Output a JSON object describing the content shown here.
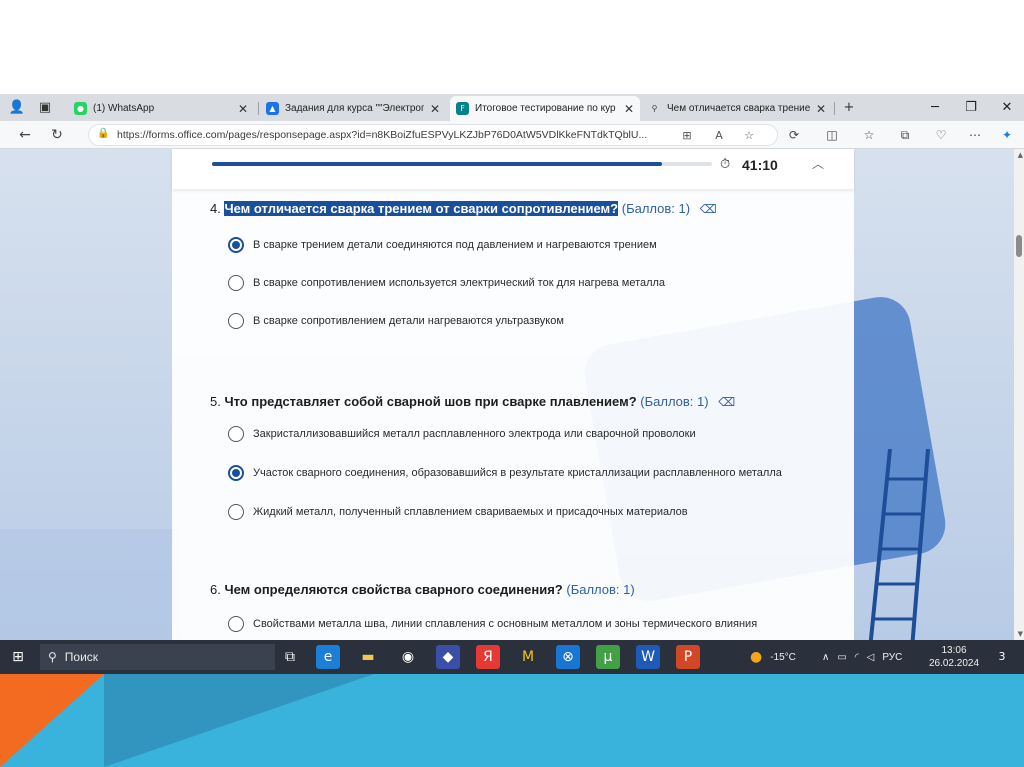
{
  "browser": {
    "tabs": [
      {
        "label": "(1) WhatsApp",
        "favicon": "whatsapp-icon",
        "color": "#25d366",
        "active": false
      },
      {
        "label": "Задания для курса \"\"Электрога",
        "favicon": "classroom-icon",
        "color": "#1a73e8",
        "active": false
      },
      {
        "label": "Итоговое тестирование по кур",
        "favicon": "forms-icon",
        "color": "#038387",
        "active": true
      },
      {
        "label": "Чем отличается сварка трение",
        "favicon": "search-icon",
        "color": "#5f6368",
        "active": false
      }
    ],
    "url": "https://forms.office.com/pages/responsepage.aspx?id=n8KBoiZfuESPVyLKZJbP76D0AtW5VDlKkeFNTdkTQblU..."
  },
  "form": {
    "progress": 0.9,
    "timer": "41:10",
    "questions": [
      {
        "number": "4.",
        "title": "Чем отличается сварка трением от сварки сопротивлением?",
        "points": "(Баллов: 1)",
        "highlighted": true,
        "options": [
          {
            "label": "В сварке трением детали соединяются под давлением и нагреваются трением",
            "selected": true
          },
          {
            "label": "В сварке сопротивлением используется электрический ток для нагрева металла",
            "selected": false
          },
          {
            "label": "В сварке сопротивлением детали нагреваются ультразвуком",
            "selected": false
          }
        ]
      },
      {
        "number": "5.",
        "title": "Что представляет собой сварной шов при сварке плавлением?",
        "points": "(Баллов: 1)",
        "highlighted": false,
        "options": [
          {
            "label": "Закристаллизовавшийся металл расплавленного электрода или сварочной проволоки",
            "selected": false
          },
          {
            "label": "Участок сварного соединения, образовавшийся в результате кристаллизации расплавленного металла",
            "selected": true
          },
          {
            "label": "Жидкий металл, полученный сплавлением свариваемых и присадочных материалов",
            "selected": false
          }
        ]
      },
      {
        "number": "6.",
        "title": "Чем определяются свойства сварного соединения?",
        "points": "(Баллов: 1)",
        "highlighted": false,
        "options": [
          {
            "label": "Свойствами металла шва, линии сплавления с основным металлом и зоны термического влияния",
            "selected": false
          }
        ]
      }
    ]
  },
  "taskbar": {
    "search_placeholder": "Поиск",
    "temperature": "-15°C",
    "language": "РУС",
    "time": "13:06",
    "date": "26.02.2024",
    "notification_count": "3"
  }
}
